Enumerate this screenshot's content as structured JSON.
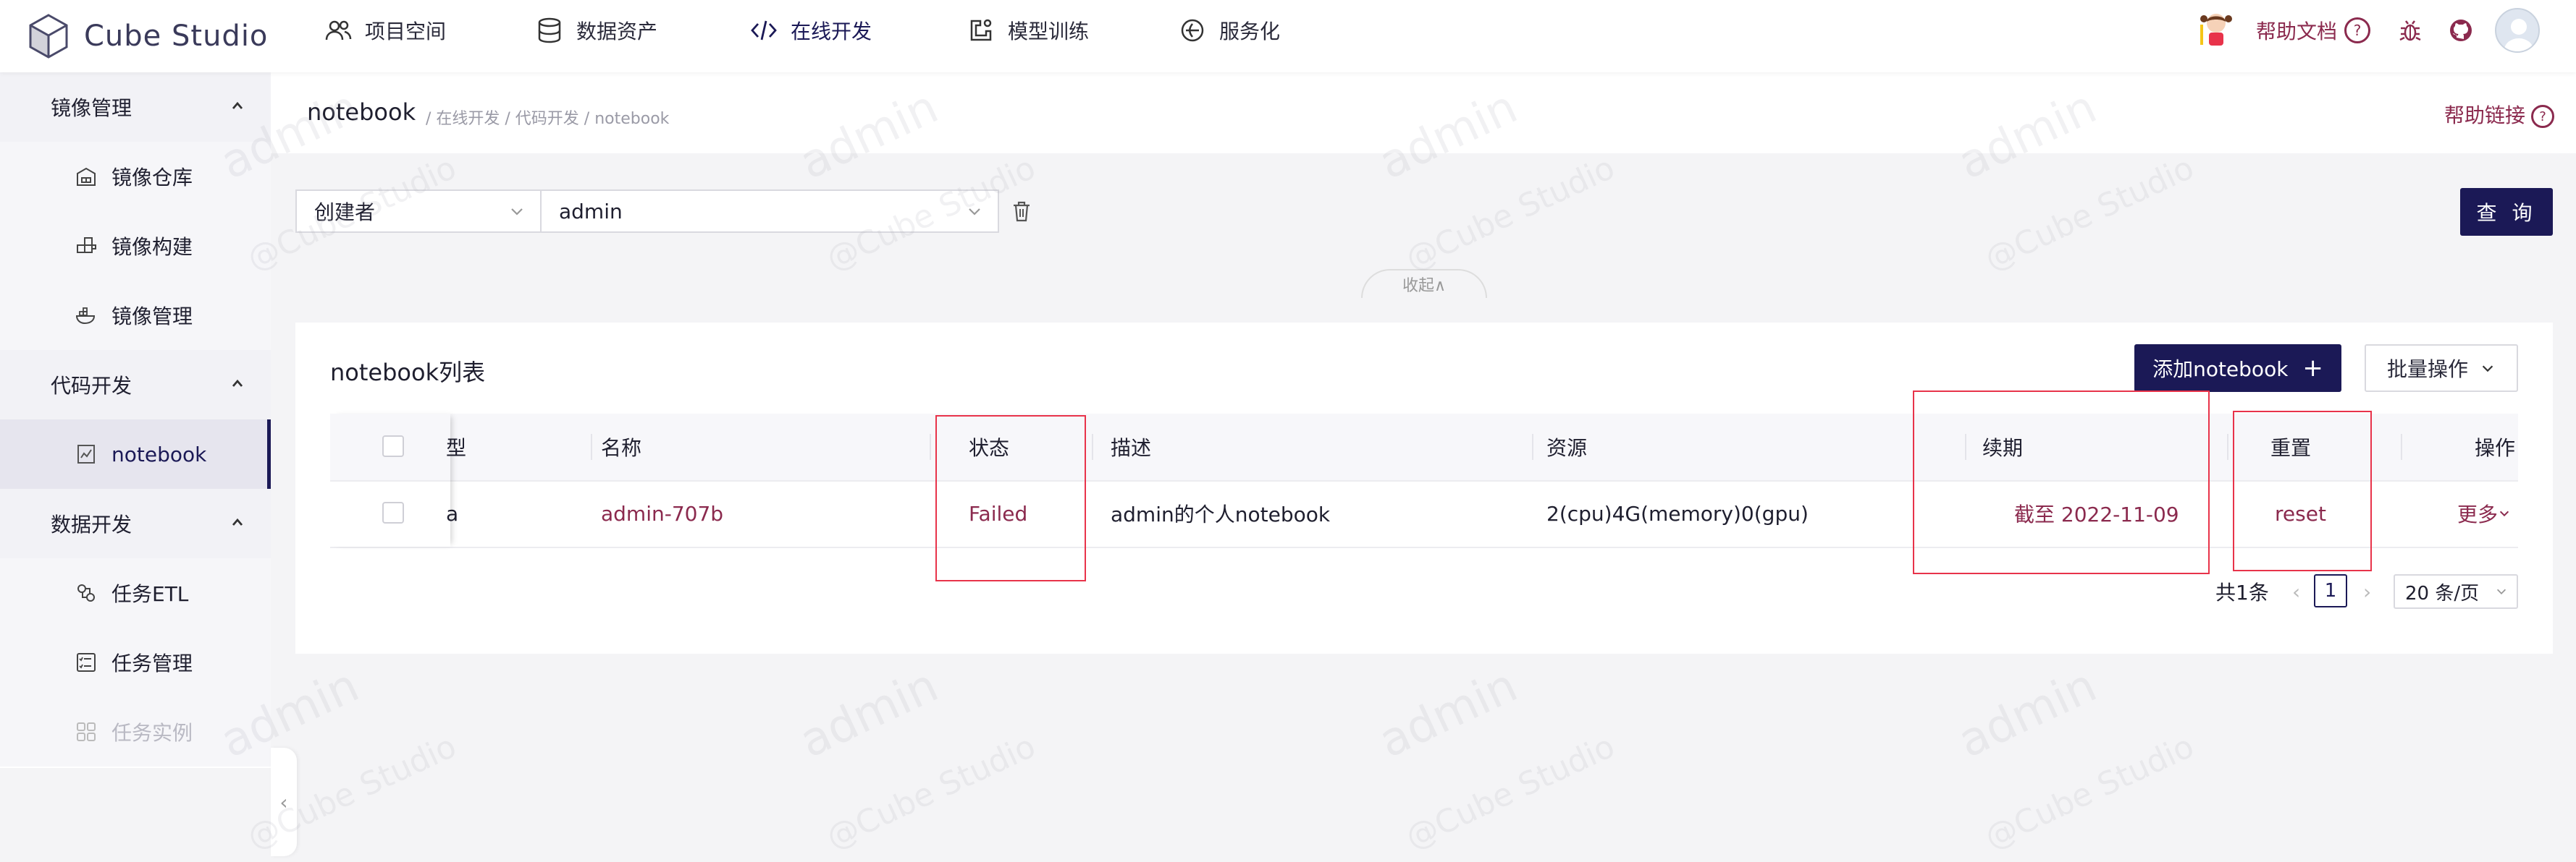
{
  "app": {
    "name": "Cube Studio"
  },
  "nav": [
    {
      "label": "项目空间",
      "icon": "users-icon"
    },
    {
      "label": "数据资产",
      "icon": "database-icon"
    },
    {
      "label": "在线开发",
      "icon": "code-icon"
    },
    {
      "label": "模型训练",
      "icon": "training-icon"
    },
    {
      "label": "服务化",
      "icon": "service-icon"
    }
  ],
  "header_right": {
    "help_doc": "帮助文档",
    "help_icon": "?"
  },
  "sidebar": {
    "groups": [
      {
        "label": "镜像管理",
        "items": [
          {
            "label": "镜像仓库"
          },
          {
            "label": "镜像构建"
          },
          {
            "label": "镜像管理"
          }
        ]
      },
      {
        "label": "代码开发",
        "items": [
          {
            "label": "notebook"
          }
        ]
      },
      {
        "label": "数据开发",
        "items": [
          {
            "label": "任务ETL"
          },
          {
            "label": "任务管理"
          },
          {
            "label": "任务实例"
          }
        ]
      }
    ]
  },
  "page": {
    "title": "notebook",
    "breadcrumb": "/ 在线开发 / 代码开发 / notebook",
    "help_link": "帮助链接"
  },
  "filter": {
    "field": "创建者",
    "value": "admin",
    "query_button": "查 询",
    "collapse": "收起∧"
  },
  "card": {
    "title": "notebook列表",
    "add_button": "添加notebook",
    "batch_button": "批量操作"
  },
  "table": {
    "headers": {
      "type": "型",
      "name": "名称",
      "status": "状态",
      "desc": "描述",
      "resource": "资源",
      "renew": "续期",
      "reset": "重置",
      "action": "操作"
    },
    "rows": [
      {
        "type": "a",
        "name": "admin-707b",
        "status": "Failed",
        "desc": "admin的个人notebook",
        "resource": "2(cpu)4G(memory)0(gpu)",
        "renew": "截至 2022-11-09",
        "reset": "reset",
        "action": "更多"
      }
    ]
  },
  "pagination": {
    "total": "共1条",
    "current": "1",
    "page_size": "20 条/页"
  },
  "watermark": {
    "text": "admin",
    "sub": "@Cube Studio"
  }
}
